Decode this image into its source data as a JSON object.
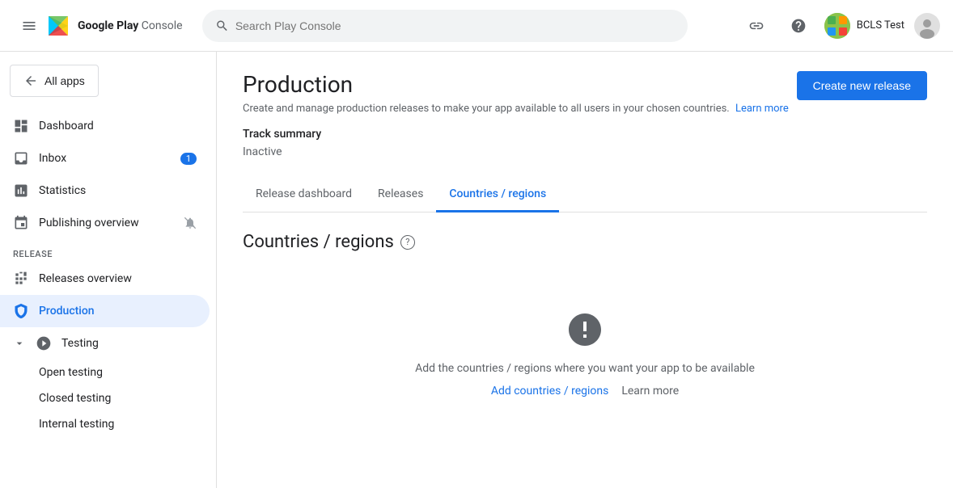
{
  "topnav": {
    "logo_text": "Google Play Console",
    "search_placeholder": "Search Play Console",
    "user_name": "BCLS Test"
  },
  "sidebar": {
    "back_label": "All apps",
    "items": [
      {
        "id": "dashboard",
        "label": "Dashboard",
        "icon": "dashboard"
      },
      {
        "id": "inbox",
        "label": "Inbox",
        "icon": "inbox",
        "badge": "1"
      },
      {
        "id": "statistics",
        "label": "Statistics",
        "icon": "statistics"
      },
      {
        "id": "publishing-overview",
        "label": "Publishing overview",
        "icon": "publishing",
        "has_notif": true
      }
    ],
    "release_section": "Release",
    "release_items": [
      {
        "id": "releases-overview",
        "label": "Releases overview",
        "icon": "releases-overview"
      },
      {
        "id": "production",
        "label": "Production",
        "icon": "production",
        "active": true
      }
    ],
    "testing_label": "Testing",
    "testing_sub_items": [
      {
        "id": "open-testing",
        "label": "Open testing"
      },
      {
        "id": "closed-testing",
        "label": "Closed testing"
      },
      {
        "id": "internal-testing",
        "label": "Internal testing"
      }
    ]
  },
  "page": {
    "title": "Production",
    "subtitle": "Create and manage production releases to make your app available to all users in your chosen countries.",
    "learn_more": "Learn more",
    "create_release_label": "Create new release"
  },
  "track_summary": {
    "title": "Track summary",
    "status": "Inactive"
  },
  "tabs": [
    {
      "id": "release-dashboard",
      "label": "Release dashboard",
      "active": false
    },
    {
      "id": "releases",
      "label": "Releases",
      "active": false
    },
    {
      "id": "countries-regions",
      "label": "Countries / regions",
      "active": true
    }
  ],
  "countries_section": {
    "title": "Countries / regions",
    "empty_text": "Add the countries / regions where you want your app to be available",
    "add_label": "Add countries / regions",
    "learn_more_label": "Learn more"
  }
}
